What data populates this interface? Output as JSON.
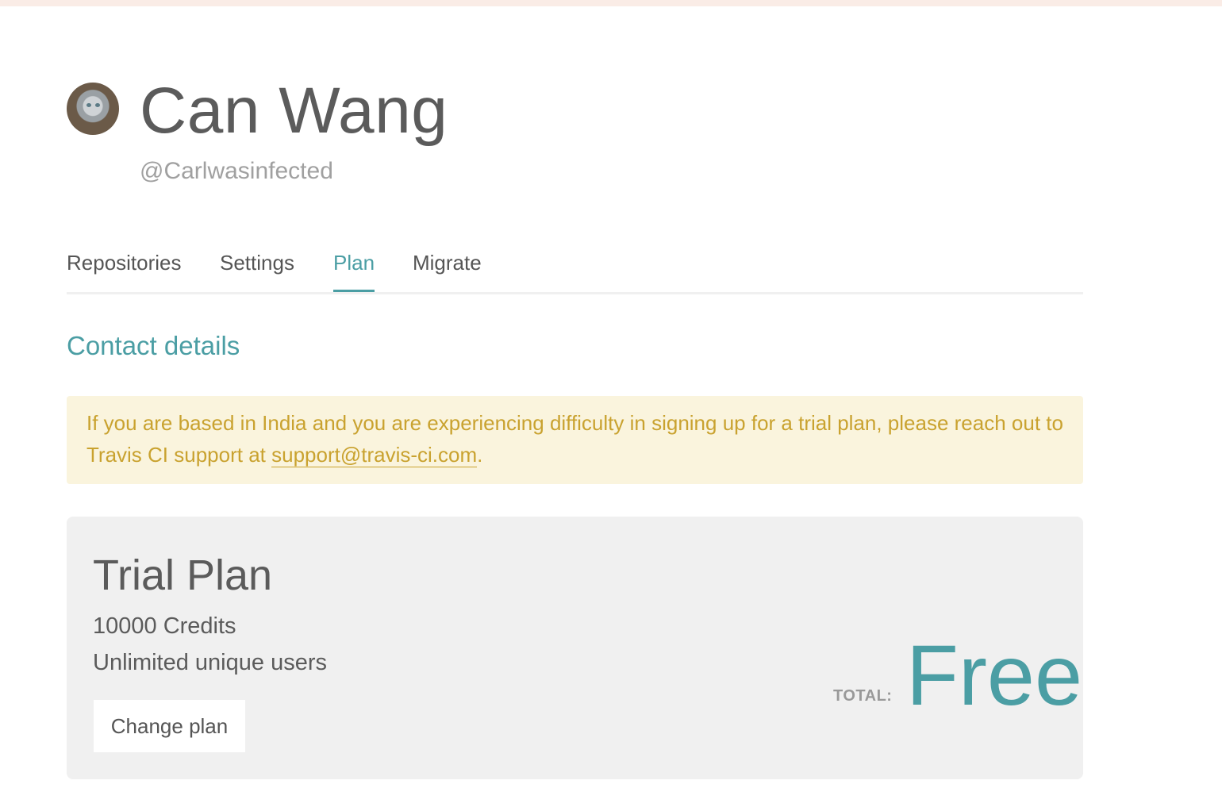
{
  "profile": {
    "name": "Can Wang",
    "handle": "@Carlwasinfected"
  },
  "tabs": [
    {
      "label": "Repositories",
      "active": false
    },
    {
      "label": "Settings",
      "active": false
    },
    {
      "label": "Plan",
      "active": true
    },
    {
      "label": "Migrate",
      "active": false
    }
  ],
  "contact": {
    "title": "Contact details"
  },
  "notice": {
    "text": "If you are based in India and you are experiencing difficulty in signing up for a trial plan, please reach out to Travis CI support at ",
    "email": "support@travis-ci.com",
    "suffix": "."
  },
  "plan": {
    "name": "Trial Plan",
    "credits": "10000 Credits",
    "users": "Unlimited unique users",
    "change_label": "Change plan",
    "total_label": "TOTAL:",
    "total_value": "Free"
  },
  "colors": {
    "accent": "#4b9ea4",
    "notice_bg": "#faf4dd",
    "notice_text": "#c9a22f",
    "card_bg": "#f0f0f0"
  }
}
